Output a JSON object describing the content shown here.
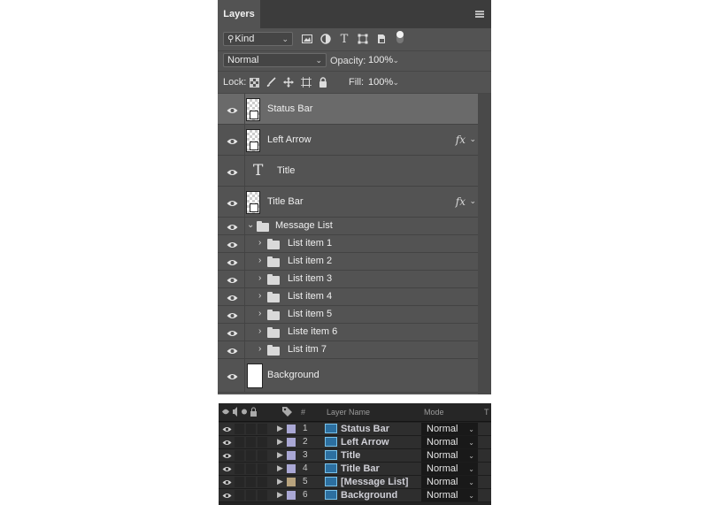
{
  "layers_panel": {
    "tab_title": "Layers",
    "filter_kind": "Kind",
    "blend_mode": "Normal",
    "opacity_label": "Opacity:",
    "opacity_value": "100%",
    "lock_label": "Lock:",
    "fill_label": "Fill:",
    "fill_value": "100%",
    "layers": [
      {
        "name": "Status Bar",
        "type": "smart",
        "selected": true,
        "fx": false
      },
      {
        "name": "Left Arrow",
        "type": "smart",
        "selected": false,
        "fx": true
      },
      {
        "name": "Title",
        "type": "text",
        "selected": false,
        "fx": false
      },
      {
        "name": "Title Bar",
        "type": "smart",
        "selected": false,
        "fx": true
      },
      {
        "name": "Message List",
        "type": "group-open",
        "selected": false,
        "fx": false
      },
      {
        "name": "List item 1",
        "type": "subgroup",
        "selected": false,
        "fx": false
      },
      {
        "name": "List item 2",
        "type": "subgroup",
        "selected": false,
        "fx": false
      },
      {
        "name": "List item 3",
        "type": "subgroup",
        "selected": false,
        "fx": false
      },
      {
        "name": "List item 4",
        "type": "subgroup",
        "selected": false,
        "fx": false
      },
      {
        "name": "List item 5",
        "type": "subgroup",
        "selected": false,
        "fx": false
      },
      {
        "name": "Liste item 6",
        "type": "subgroup",
        "selected": false,
        "fx": false
      },
      {
        "name": "List itm 7",
        "type": "subgroup",
        "selected": false,
        "fx": false
      },
      {
        "name": "Background",
        "type": "background",
        "selected": false,
        "fx": false
      }
    ],
    "fx_label": "fx"
  },
  "timeline": {
    "col_num": "#",
    "col_layer_name": "Layer Name",
    "col_mode": "Mode",
    "col_t": "T",
    "rows": [
      {
        "num": "1",
        "name": "Status Bar",
        "mode": "Normal",
        "label_color": "#a9a7d4"
      },
      {
        "num": "2",
        "name": "Left Arrow",
        "mode": "Normal",
        "label_color": "#a9a7d4"
      },
      {
        "num": "3",
        "name": "Title",
        "mode": "Normal",
        "label_color": "#a9a7d4"
      },
      {
        "num": "4",
        "name": "Title Bar",
        "mode": "Normal",
        "label_color": "#a9a7d4"
      },
      {
        "num": "5",
        "name": "[Message List]",
        "mode": "Normal",
        "label_color": "#b7a27d"
      },
      {
        "num": "6",
        "name": "Background",
        "mode": "Normal",
        "label_color": "#a9a7d4"
      }
    ]
  }
}
